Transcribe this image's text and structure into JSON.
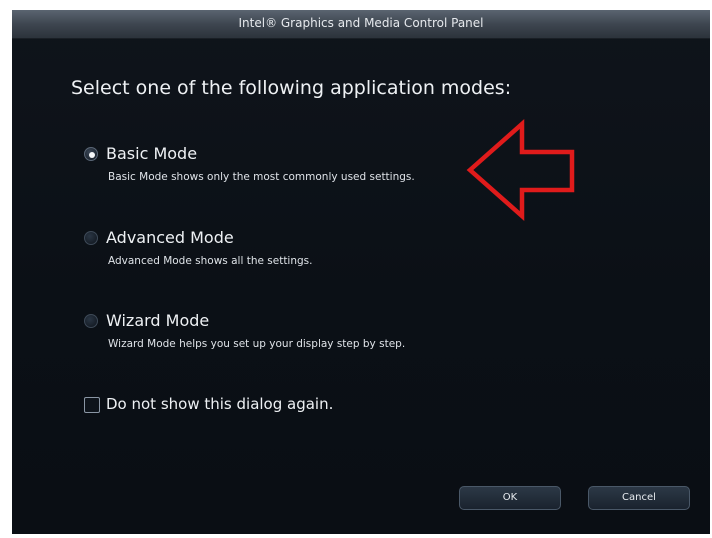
{
  "window": {
    "title": "Intel® Graphics and Media Control Panel"
  },
  "dialog": {
    "heading": "Select one of the following application modes:",
    "options": [
      {
        "label": "Basic Mode",
        "description": "Basic Mode shows only the most commonly used settings.",
        "selected": true
      },
      {
        "label": "Advanced Mode",
        "description": "Advanced Mode shows all the settings.",
        "selected": false
      },
      {
        "label": "Wizard Mode",
        "description": "Wizard Mode helps you set up your display step by step.",
        "selected": false
      }
    ],
    "dont_show_again": {
      "label": "Do not show this dialog again.",
      "checked": false
    },
    "buttons": {
      "ok_label": "OK",
      "cancel_label": "Cancel"
    }
  },
  "annotation": {
    "arrow_color": "#e01b1b",
    "arrow_icon": "red-outline-arrow-pointing-left"
  },
  "colors": {
    "dialog_background": "#0b1016",
    "titlebar": "#3e4650",
    "text": "#eef1f4"
  }
}
